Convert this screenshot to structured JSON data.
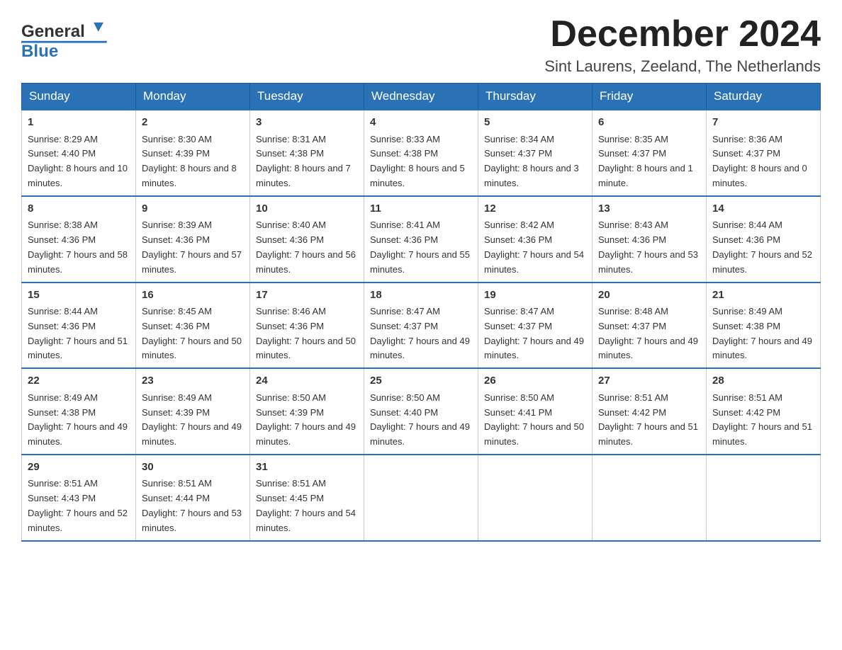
{
  "logo": {
    "brand": "General",
    "blue": "Blue"
  },
  "header": {
    "month": "December 2024",
    "location": "Sint Laurens, Zeeland, The Netherlands"
  },
  "days": [
    "Sunday",
    "Monday",
    "Tuesday",
    "Wednesday",
    "Thursday",
    "Friday",
    "Saturday"
  ],
  "weeks": [
    [
      {
        "num": "1",
        "sunrise": "8:29 AM",
        "sunset": "4:40 PM",
        "daylight": "8 hours and 10 minutes."
      },
      {
        "num": "2",
        "sunrise": "8:30 AM",
        "sunset": "4:39 PM",
        "daylight": "8 hours and 8 minutes."
      },
      {
        "num": "3",
        "sunrise": "8:31 AM",
        "sunset": "4:38 PM",
        "daylight": "8 hours and 7 minutes."
      },
      {
        "num": "4",
        "sunrise": "8:33 AM",
        "sunset": "4:38 PM",
        "daylight": "8 hours and 5 minutes."
      },
      {
        "num": "5",
        "sunrise": "8:34 AM",
        "sunset": "4:37 PM",
        "daylight": "8 hours and 3 minutes."
      },
      {
        "num": "6",
        "sunrise": "8:35 AM",
        "sunset": "4:37 PM",
        "daylight": "8 hours and 1 minute."
      },
      {
        "num": "7",
        "sunrise": "8:36 AM",
        "sunset": "4:37 PM",
        "daylight": "8 hours and 0 minutes."
      }
    ],
    [
      {
        "num": "8",
        "sunrise": "8:38 AM",
        "sunset": "4:36 PM",
        "daylight": "7 hours and 58 minutes."
      },
      {
        "num": "9",
        "sunrise": "8:39 AM",
        "sunset": "4:36 PM",
        "daylight": "7 hours and 57 minutes."
      },
      {
        "num": "10",
        "sunrise": "8:40 AM",
        "sunset": "4:36 PM",
        "daylight": "7 hours and 56 minutes."
      },
      {
        "num": "11",
        "sunrise": "8:41 AM",
        "sunset": "4:36 PM",
        "daylight": "7 hours and 55 minutes."
      },
      {
        "num": "12",
        "sunrise": "8:42 AM",
        "sunset": "4:36 PM",
        "daylight": "7 hours and 54 minutes."
      },
      {
        "num": "13",
        "sunrise": "8:43 AM",
        "sunset": "4:36 PM",
        "daylight": "7 hours and 53 minutes."
      },
      {
        "num": "14",
        "sunrise": "8:44 AM",
        "sunset": "4:36 PM",
        "daylight": "7 hours and 52 minutes."
      }
    ],
    [
      {
        "num": "15",
        "sunrise": "8:44 AM",
        "sunset": "4:36 PM",
        "daylight": "7 hours and 51 minutes."
      },
      {
        "num": "16",
        "sunrise": "8:45 AM",
        "sunset": "4:36 PM",
        "daylight": "7 hours and 50 minutes."
      },
      {
        "num": "17",
        "sunrise": "8:46 AM",
        "sunset": "4:36 PM",
        "daylight": "7 hours and 50 minutes."
      },
      {
        "num": "18",
        "sunrise": "8:47 AM",
        "sunset": "4:37 PM",
        "daylight": "7 hours and 49 minutes."
      },
      {
        "num": "19",
        "sunrise": "8:47 AM",
        "sunset": "4:37 PM",
        "daylight": "7 hours and 49 minutes."
      },
      {
        "num": "20",
        "sunrise": "8:48 AM",
        "sunset": "4:37 PM",
        "daylight": "7 hours and 49 minutes."
      },
      {
        "num": "21",
        "sunrise": "8:49 AM",
        "sunset": "4:38 PM",
        "daylight": "7 hours and 49 minutes."
      }
    ],
    [
      {
        "num": "22",
        "sunrise": "8:49 AM",
        "sunset": "4:38 PM",
        "daylight": "7 hours and 49 minutes."
      },
      {
        "num": "23",
        "sunrise": "8:49 AM",
        "sunset": "4:39 PM",
        "daylight": "7 hours and 49 minutes."
      },
      {
        "num": "24",
        "sunrise": "8:50 AM",
        "sunset": "4:39 PM",
        "daylight": "7 hours and 49 minutes."
      },
      {
        "num": "25",
        "sunrise": "8:50 AM",
        "sunset": "4:40 PM",
        "daylight": "7 hours and 49 minutes."
      },
      {
        "num": "26",
        "sunrise": "8:50 AM",
        "sunset": "4:41 PM",
        "daylight": "7 hours and 50 minutes."
      },
      {
        "num": "27",
        "sunrise": "8:51 AM",
        "sunset": "4:42 PM",
        "daylight": "7 hours and 51 minutes."
      },
      {
        "num": "28",
        "sunrise": "8:51 AM",
        "sunset": "4:42 PM",
        "daylight": "7 hours and 51 minutes."
      }
    ],
    [
      {
        "num": "29",
        "sunrise": "8:51 AM",
        "sunset": "4:43 PM",
        "daylight": "7 hours and 52 minutes."
      },
      {
        "num": "30",
        "sunrise": "8:51 AM",
        "sunset": "4:44 PM",
        "daylight": "7 hours and 53 minutes."
      },
      {
        "num": "31",
        "sunrise": "8:51 AM",
        "sunset": "4:45 PM",
        "daylight": "7 hours and 54 minutes."
      },
      null,
      null,
      null,
      null
    ]
  ],
  "labels": {
    "sunrise": "Sunrise:",
    "sunset": "Sunset:",
    "daylight": "Daylight:"
  }
}
